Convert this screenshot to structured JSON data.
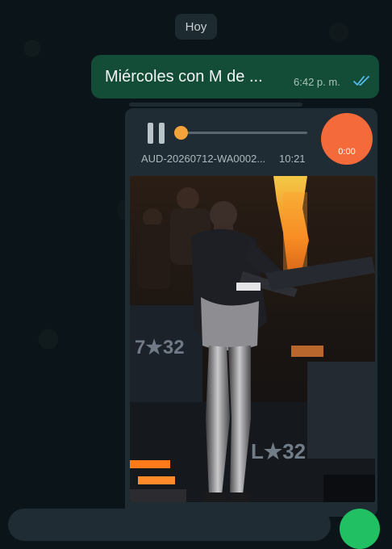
{
  "chat": {
    "date_label": "Hoy",
    "outgoing_message": {
      "text": "Miércoles con M de ...",
      "time": "6:42 p. m.",
      "read_status": "read-double-check-icon",
      "bubble_color": "#144d37"
    },
    "audio_message": {
      "file_name": "AUD-20260712-WA0002...",
      "duration": "10:21",
      "elapsed": "0:00",
      "progress": 0,
      "state": "playing",
      "avatar_color": "#f56a3a",
      "knob_color": "#f4a23c"
    },
    "photo_message": {
      "subject": "concert-performer-photo",
      "stage_text": "7 32"
    }
  },
  "composer": {
    "mic_color": "#21c063"
  },
  "colors": {
    "background": "#0b1418",
    "incoming_bubble": "#1f2c33",
    "tick_blue": "#53bdeb"
  }
}
